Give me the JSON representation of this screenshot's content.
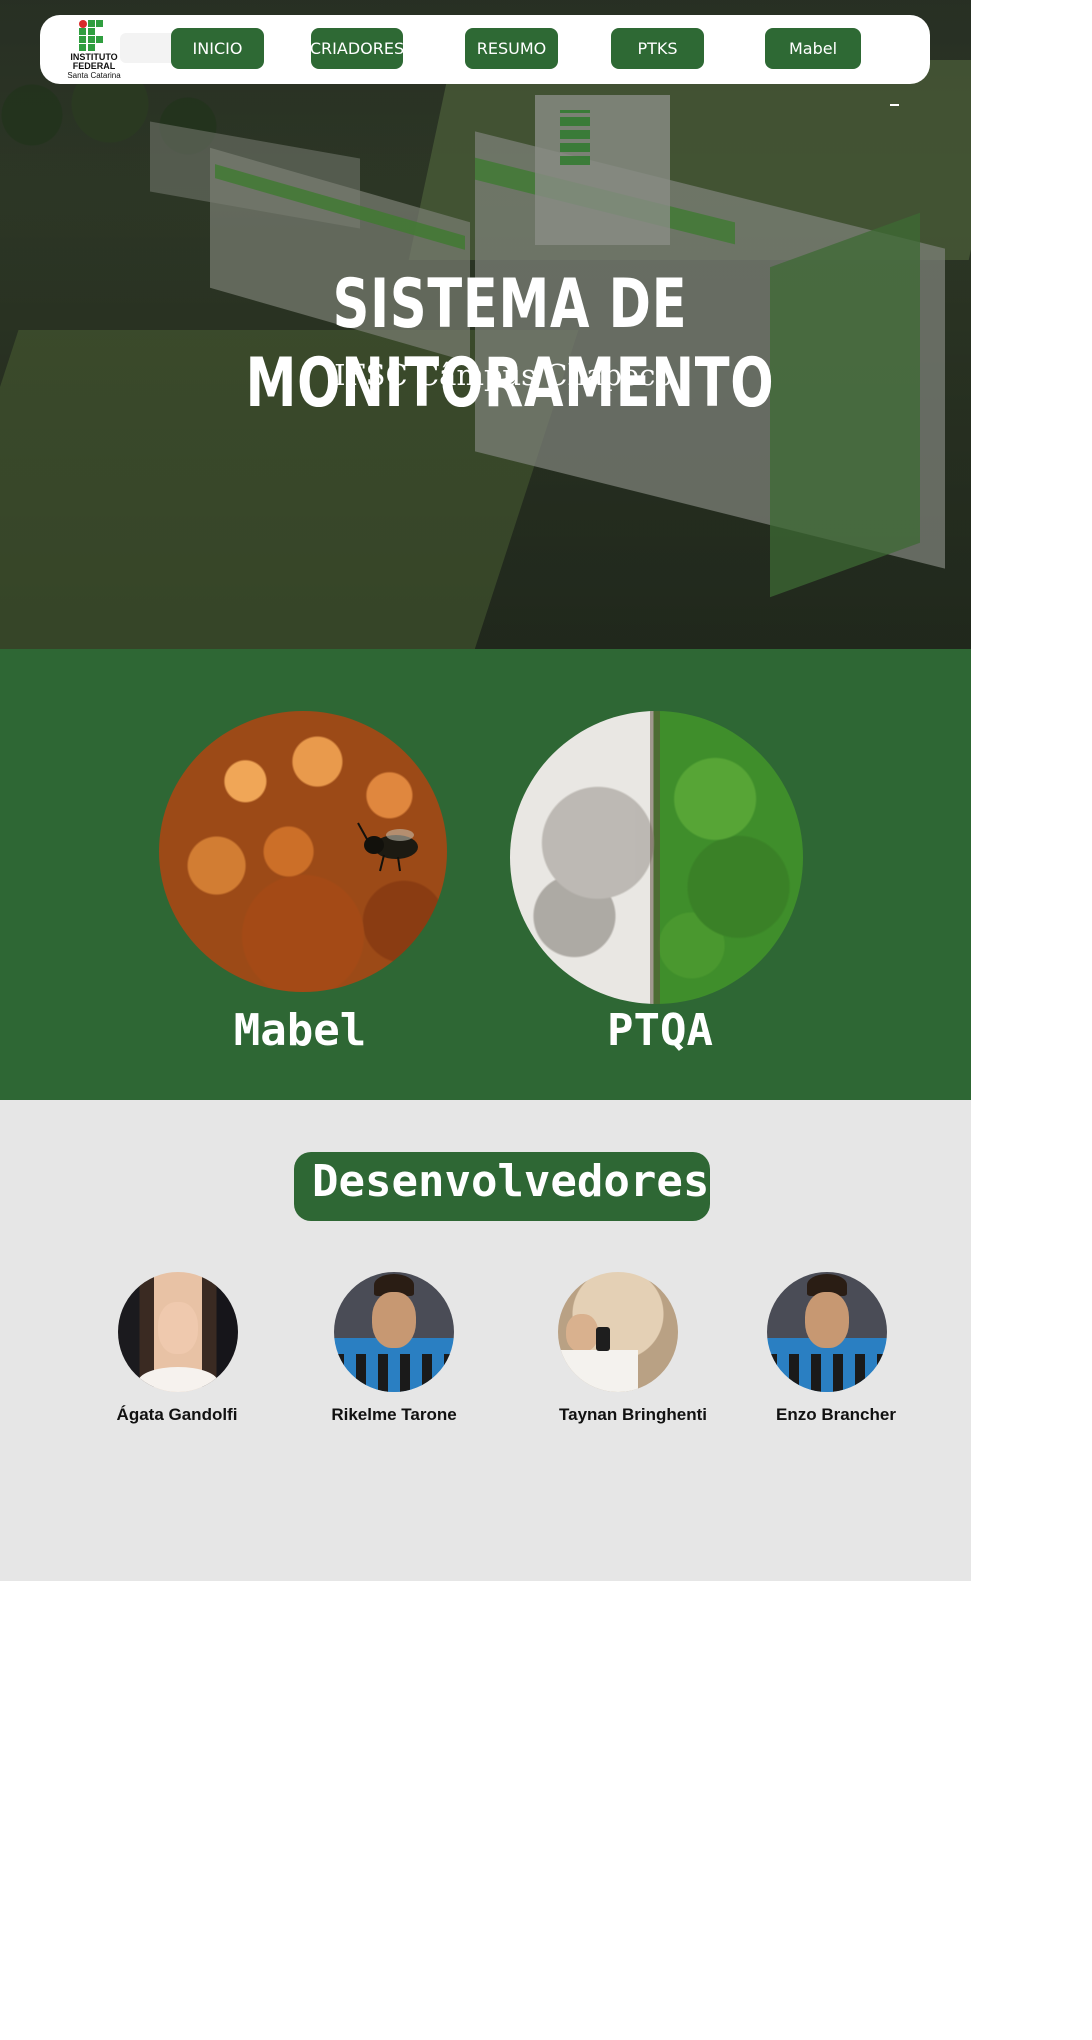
{
  "nav": {
    "logo": {
      "line1": "INSTITUTO",
      "line2": "FEDERAL",
      "line3": "Santa Catarina"
    },
    "buttons": [
      {
        "label": "INICIO"
      },
      {
        "label": "CRIADORES"
      },
      {
        "label": "RESUMO"
      },
      {
        "label": "PTKS"
      },
      {
        "label": "Mabel"
      }
    ]
  },
  "hero": {
    "title": "SISTEMA DE MONITORAMENTO",
    "subtitle": "IFSC Câmpus Chapecó"
  },
  "projects": {
    "background_color": "#2e6734",
    "items": [
      {
        "label": "Mabel",
        "image": "bee-honeycomb-photo"
      },
      {
        "label": "PTQA",
        "image": "tree-head-photo"
      }
    ]
  },
  "developers": {
    "title": "Desenvolvedores",
    "people": [
      {
        "name": "Ágata Gandolfi"
      },
      {
        "name": "Rikelme Tarone"
      },
      {
        "name": "Taynan Bringhenti"
      },
      {
        "name": "Enzo Brancher"
      }
    ]
  },
  "colors": {
    "accent_green": "#2e6934",
    "section_gray": "#e6e6e6"
  }
}
